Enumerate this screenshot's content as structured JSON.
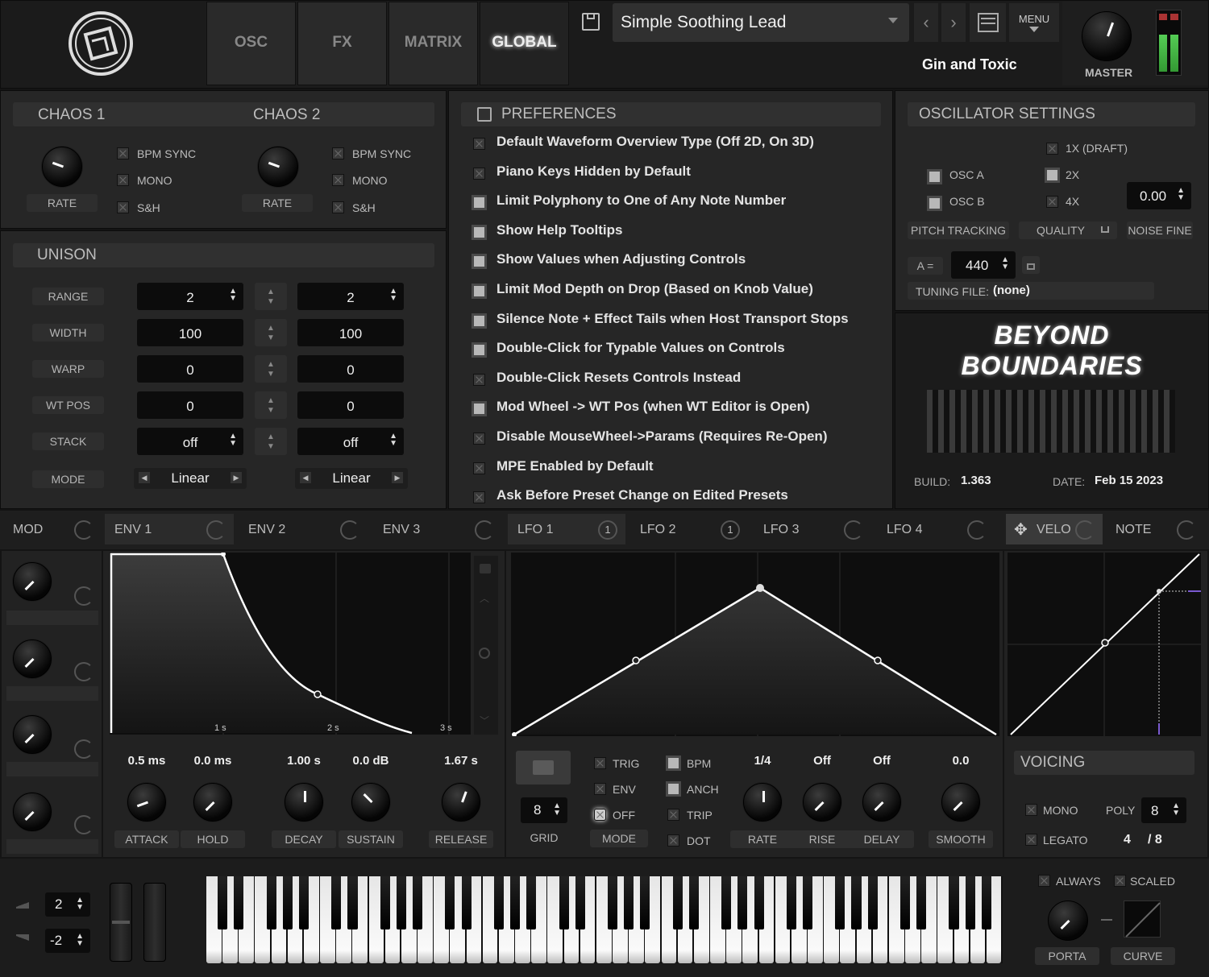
{
  "top": {
    "tabs": [
      "OSC",
      "FX",
      "MATRIX",
      "GLOBAL"
    ],
    "active_tab": "GLOBAL",
    "preset_name": "Simple Soothing Lead",
    "preset_author": "Gin and Toxic",
    "menu_label": "MENU",
    "master_label": "MASTER"
  },
  "chaos": {
    "chaos1_title": "CHAOS 1",
    "chaos2_title": "CHAOS 2",
    "rate_label": "RATE",
    "options": [
      "BPM SYNC",
      "MONO",
      "S&H"
    ]
  },
  "unison": {
    "title": "UNISON",
    "rows": [
      {
        "label": "RANGE",
        "a": "2",
        "b": "2"
      },
      {
        "label": "WIDTH",
        "a": "100",
        "b": "100"
      },
      {
        "label": "WARP",
        "a": "0",
        "b": "0"
      },
      {
        "label": "WT POS",
        "a": "0",
        "b": "0"
      },
      {
        "label": "STACK",
        "a": "off",
        "b": "off"
      },
      {
        "label": "MODE",
        "a": "Linear",
        "b": "Linear"
      }
    ]
  },
  "preferences": {
    "title": "PREFERENCES",
    "items": [
      {
        "label": "Default Waveform Overview Type (Off 2D, On 3D)",
        "checked": false
      },
      {
        "label": "Piano Keys Hidden by Default",
        "checked": false
      },
      {
        "label": "Limit Polyphony to One of Any Note Number",
        "checked": true
      },
      {
        "label": "Show Help Tooltips",
        "checked": true
      },
      {
        "label": "Show Values when Adjusting Controls",
        "checked": true
      },
      {
        "label": "Limit Mod Depth on Drop (Based on Knob Value)",
        "checked": true
      },
      {
        "label": "Silence Note + Effect Tails when Host Transport Stops",
        "checked": true
      },
      {
        "label": "Double-Click for Typable Values on Controls",
        "checked": true
      },
      {
        "label": "Double-Click Resets Controls Instead",
        "checked": false
      },
      {
        "label": "Mod Wheel -> WT Pos (when WT Editor is Open)",
        "checked": true
      },
      {
        "label": "Disable MouseWheel->Params (Requires Re-Open)",
        "checked": false
      },
      {
        "label": "MPE Enabled by Default",
        "checked": false
      },
      {
        "label": "Ask Before Preset Change on Edited Presets",
        "checked": false
      }
    ]
  },
  "osc_settings": {
    "title": "OSCILLATOR SETTINGS",
    "osc_a": "OSC A",
    "osc_b": "OSC B",
    "quality_opts": [
      "1X (DRAFT)",
      "2X",
      "4X"
    ],
    "noise_fine_value": "0.00",
    "pitch_tracking": "PITCH TRACKING",
    "quality": "QUALITY",
    "noise_fine": "NOISE FINE",
    "a_eq": "A =",
    "a_value": "440",
    "tuning_label": "TUNING FILE:",
    "tuning_value": "(none)"
  },
  "about": {
    "line1": "BEYOND",
    "line2": "BOUNDARIES",
    "build_label": "BUILD:",
    "build_value": "1.363",
    "date_label": "DATE:",
    "date_value": "Feb 15 2023"
  },
  "mod_tabs": [
    {
      "label": "MOD"
    },
    {
      "label": "ENV 1"
    },
    {
      "label": "ENV 2"
    },
    {
      "label": "ENV 3"
    },
    {
      "label": "LFO 1",
      "badge": "1"
    },
    {
      "label": "LFO 2",
      "badge": "1"
    },
    {
      "label": "LFO 3"
    },
    {
      "label": "LFO 4"
    },
    {
      "label": "VELO"
    },
    {
      "label": "NOTE"
    }
  ],
  "env": {
    "time_labels": [
      "1 s",
      "2 s",
      "3 s"
    ],
    "values": [
      "0.5 ms",
      "0.0 ms",
      "1.00 s",
      "0.0 dB",
      "1.67 s"
    ],
    "labels": [
      "ATTACK",
      "HOLD",
      "DECAY",
      "SUSTAIN",
      "RELEASE"
    ]
  },
  "lfo": {
    "grid_value": "8",
    "grid_label": "GRID",
    "mode_label": "MODE",
    "mode_opts": [
      {
        "label": "TRIG",
        "checked": false
      },
      {
        "label": "ENV",
        "checked": false
      },
      {
        "label": "OFF",
        "checked": true
      }
    ],
    "bpm_opts": [
      {
        "label": "BPM",
        "checked": true
      },
      {
        "label": "ANCH",
        "checked": true
      },
      {
        "label": "TRIP",
        "checked": false
      },
      {
        "label": "DOT",
        "checked": false
      }
    ],
    "values": [
      "1/4",
      "Off",
      "Off",
      "0.0"
    ],
    "labels": [
      "RATE",
      "RISE",
      "DELAY",
      "SMOOTH"
    ]
  },
  "voicing": {
    "title": "VOICING",
    "mono": "MONO",
    "legato": "LEGATO",
    "poly_label": "POLY",
    "poly_value": "8",
    "voices_now": "4",
    "voices_total": "/ 8"
  },
  "keyboard": {
    "bend_up": "2",
    "bend_down": "-2",
    "always": "ALWAYS",
    "scaled": "SCALED",
    "porta": "PORTA",
    "curve": "CURVE"
  }
}
